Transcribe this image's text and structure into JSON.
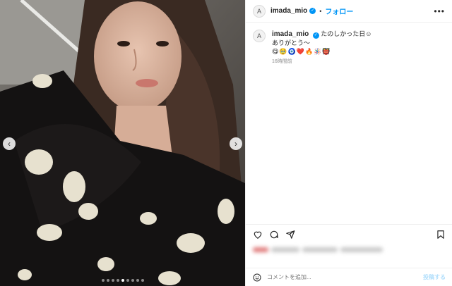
{
  "post": {
    "username": "imada_mio",
    "follow_label": "フォロー",
    "separator": "•",
    "more_label": "•••",
    "avatar_glyph": "A",
    "caption_line1": "たのしかった日☺︎",
    "caption_line2": "ありがとう〜",
    "caption_emojis": "😋🥹🧿❤️🔥🪅👹",
    "timestamp": "16時間前",
    "nav_prev": "‹",
    "nav_next": "›",
    "slide_count": 9,
    "active_slide": 5
  },
  "comment": {
    "placeholder": "コメントを追加...",
    "post_label": "投稿する",
    "emoji_icon": "smiley-icon"
  },
  "colors": {
    "accent": "#0095f6",
    "text": "#262626",
    "muted": "#8e8e8e"
  }
}
